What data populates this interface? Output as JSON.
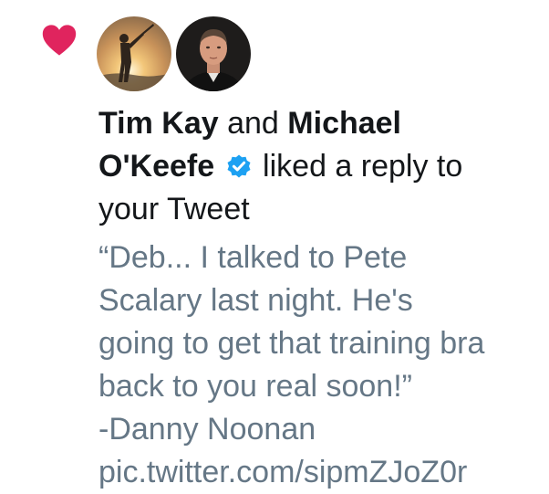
{
  "notification": {
    "liker_1": "Tim Kay",
    "connector": "and",
    "liker_2_part1": "Michael",
    "liker_2_part2": "O'Keefe",
    "action_part1": "liked a reply to",
    "action_part2": "your Tweet",
    "icons": {
      "like": "heart-icon",
      "verified": "verified-badge-icon"
    },
    "colors": {
      "heart": "#e0245e",
      "verified": "#1da1f2",
      "primary_text": "#14171a",
      "secondary_text": "#657786"
    }
  },
  "tweet": {
    "lines": [
      "“Deb... I talked to Pete",
      "Scalary last night.  He's",
      "going to get that training bra",
      "back to you real soon!”",
      "-Danny Noonan",
      "pic.twitter.com/sipmZJoZ0r"
    ]
  }
}
